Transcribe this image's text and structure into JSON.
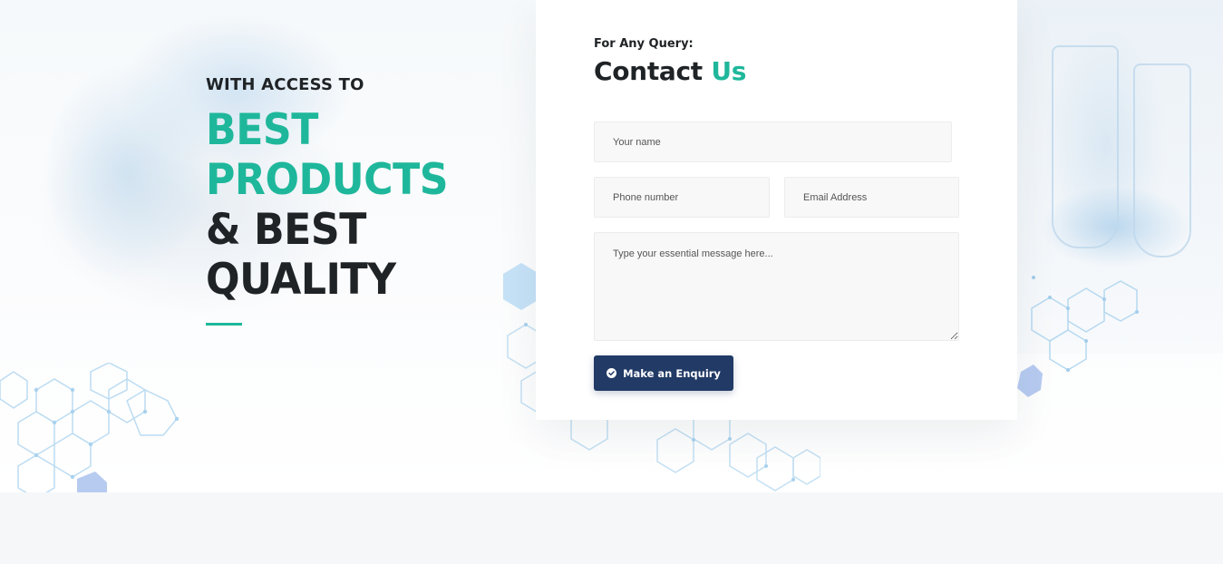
{
  "hero": {
    "kicker": "WITH ACCESS TO",
    "line1": "BEST",
    "line2": "PRODUCTS",
    "line3": "& BEST",
    "line4": "QUALITY"
  },
  "contact": {
    "kicker": "For Any Query:",
    "title_main": "Contact",
    "title_accent": "Us",
    "name_placeholder": "Your name",
    "phone_placeholder": "Phone number",
    "email_placeholder": "Email Address",
    "message_placeholder": "Type your essential message here...",
    "submit_label": "Make an Enquiry",
    "submit_icon": "check-circle-icon"
  },
  "colors": {
    "accent": "#1fb79b",
    "button": "#213a66",
    "text": "#1f2326",
    "field_bg": "#f8f8f8",
    "band": "#f6f7f9"
  }
}
